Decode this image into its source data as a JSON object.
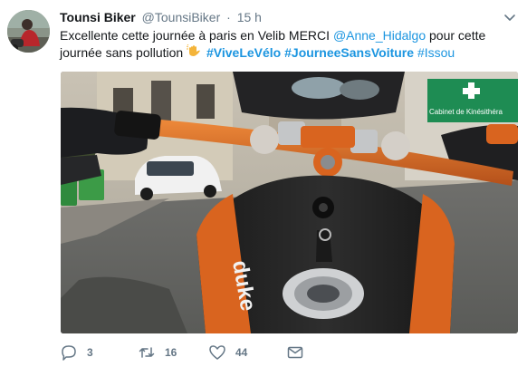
{
  "tweet": {
    "author_name": "Tounsi Biker",
    "handle": "@TounsiBiker",
    "separator": "·",
    "time": "15 h",
    "text": {
      "part1": "Excellente cette journée à paris en Velib MERCI ",
      "mention": "@Anne_Hidalgo",
      "part2": " pour cette journée sans pollution ",
      "emoji_icon": "waving-hand-icon",
      "hashtag1": "#ViveLeVélo",
      "hashtag2": "#JourneeSansVoiture",
      "hashtag3": "#Issou"
    },
    "media": {
      "sign_text": "Cabinet de Kinésithéra",
      "tank_text": "duke"
    },
    "actions": {
      "reply_count": "3",
      "retweet_count": "16",
      "like_count": "44"
    }
  },
  "colors": {
    "link": "#1b95e0",
    "muted": "#657786",
    "handlebar_orange": "#d9641f"
  }
}
